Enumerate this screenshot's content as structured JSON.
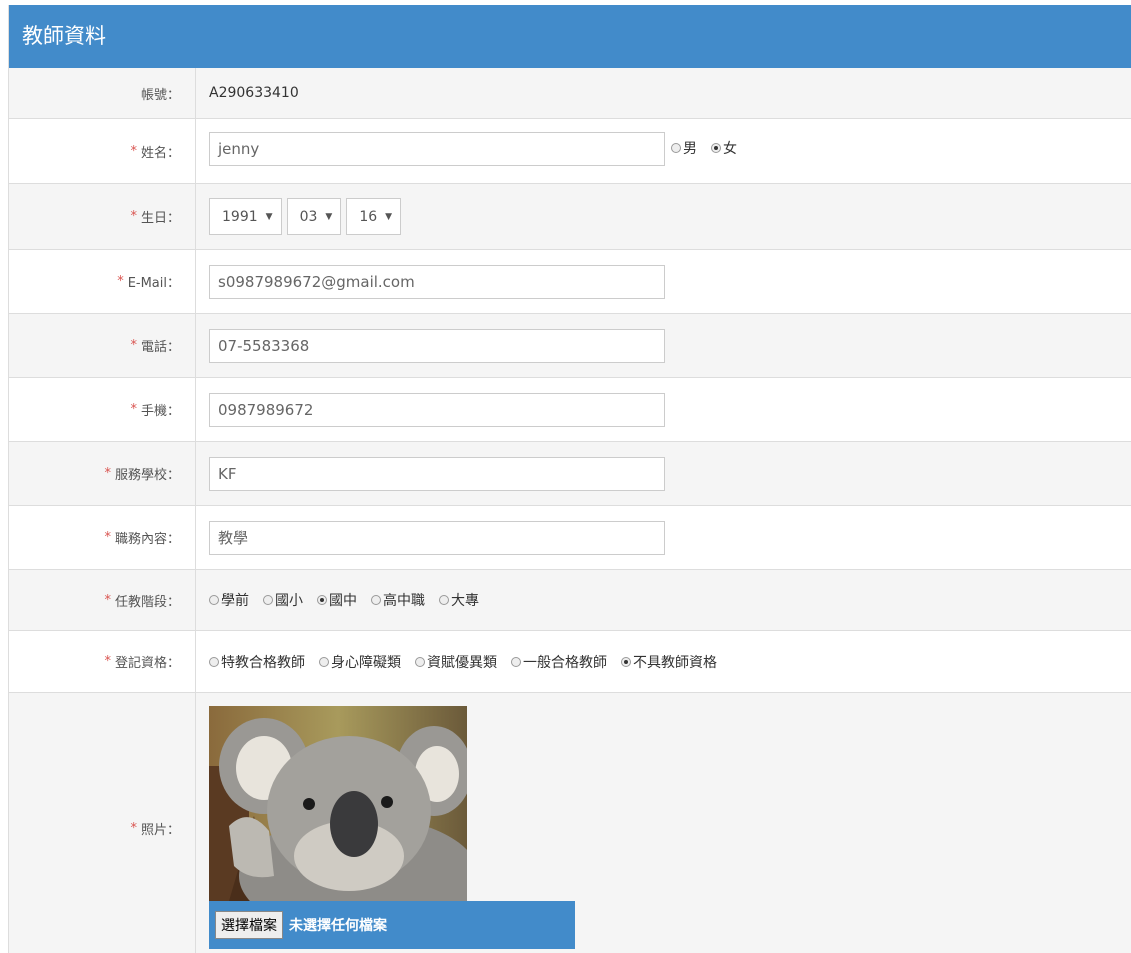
{
  "panel": {
    "title": "教師資料"
  },
  "account": {
    "label": "帳號：",
    "value": "A290633410"
  },
  "name": {
    "label": "姓名：",
    "value": "jenny",
    "gender_options": [
      "男",
      "女"
    ],
    "gender_selected": "女"
  },
  "birthday": {
    "label": "生日：",
    "year": "1991",
    "month": "03",
    "day": "16",
    "caret": "▼"
  },
  "email": {
    "label": "E-Mail：",
    "value": "s0987989672@gmail.com"
  },
  "phone": {
    "label": "電話：",
    "value": "07-5583368"
  },
  "mobile": {
    "label": "手機：",
    "value": "0987989672"
  },
  "school": {
    "label": "服務學校：",
    "value": "KF"
  },
  "duty": {
    "label": "職務內容：",
    "value": "教學"
  },
  "stage": {
    "label": "任教階段：",
    "options": [
      "學前",
      "國小",
      "國中",
      "高中職",
      "大專"
    ],
    "selected": "國中"
  },
  "qualification": {
    "label": "登記資格：",
    "options": [
      "特教合格教師",
      "身心障礙類",
      "資賦優異類",
      "一般合格教師",
      "不具教師資格"
    ],
    "selected": "不具教師資格"
  },
  "photo": {
    "label": "照片：",
    "choose_button": "選擇檔案",
    "no_file_text": "未選擇任何檔案"
  },
  "required_mark": "*",
  "colors": {
    "header_bg": "#428bca",
    "required": "#d9534f"
  }
}
